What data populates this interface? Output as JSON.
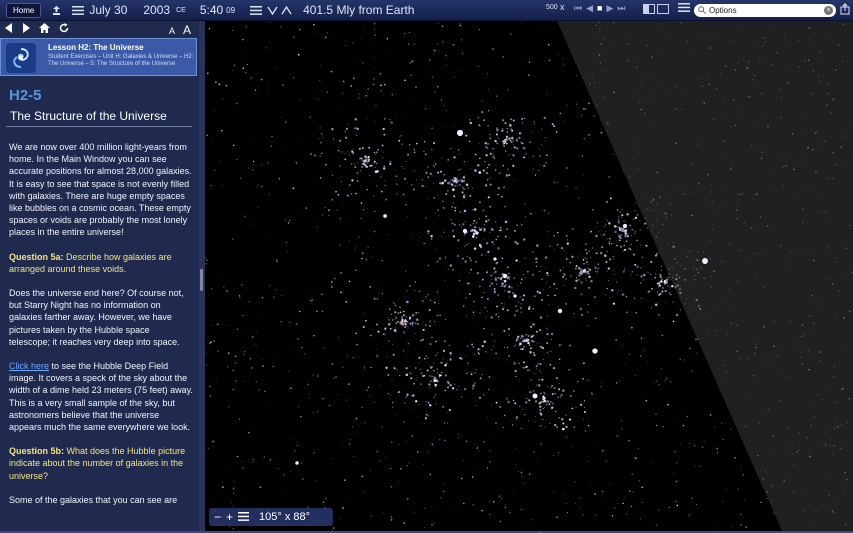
{
  "toolbar": {
    "home_label": "Home",
    "date_month": "July 30",
    "date_year": "2003",
    "date_era": "CE",
    "time": "5:40",
    "time_seconds": "09",
    "distance": "401.5 Mly from Earth",
    "time_rate": "500",
    "time_rate_unit": "x",
    "search_value": "Options"
  },
  "sidebar": {
    "lesson_title": "Lesson H2: The Universe",
    "breadcrumb": "Student Exercises – Unit H: Galaxies & Universe – H2: The Universe – 5: The Structure of the Universe",
    "section_id": "H2-5",
    "section_title": "The Structure of the Universe",
    "para1": "We are now over 400 million light-years from home. In the Main Window you can see accurate positions for almost 28,000 galaxies. It is easy to see that space is not evenly filled with galaxies. There are huge empty spaces like bubbles on a cosmic ocean. These empty spaces or voids are probably the most lonely places in the entire universe!",
    "q5a_label": "Question 5a:",
    "q5a_text": " Describe how galaxies are arranged around these voids.",
    "para2": "Does the universe end here? Of course not, but Starry Night has no information on galaxies farther away. However, we have pictures taken by the Hubble space telescope; it reaches very deep into space.",
    "link_text": "Click here",
    "para3": " to see the Hubble Deep Field image. It covers a speck of the sky about the width of a dime held 23 meters (75 feet) away. This is a very small sample of the sky, but astronomers believe that the universe appears much the same everywhere we look.",
    "q5b_label": "Question 5b:",
    "q5b_text": " What does the Hubble picture indicate about the number of galaxies in the universe?",
    "para4": "Some of the galaxies that you can see are",
    "font_small": "A",
    "font_large": "A"
  },
  "sky": {
    "fov": "105° x 88°"
  }
}
